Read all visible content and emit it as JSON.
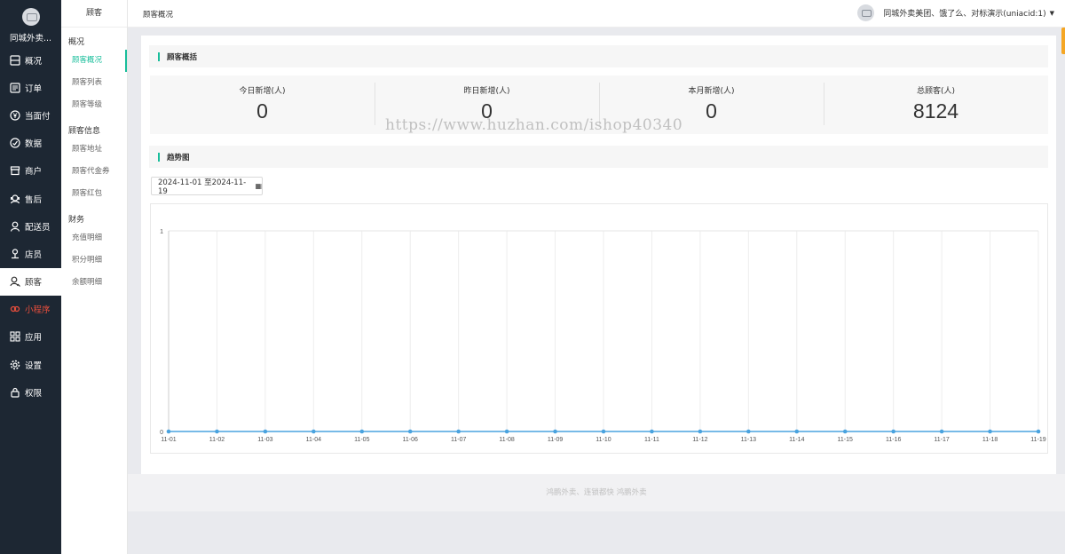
{
  "brand": {
    "name": "同城外卖..."
  },
  "nav": [
    {
      "key": "overview",
      "label": "概况",
      "icon": "overview-icon"
    },
    {
      "key": "orders",
      "label": "订单",
      "icon": "order-list-icon"
    },
    {
      "key": "pay",
      "label": "当面付",
      "icon": "yen-icon"
    },
    {
      "key": "data",
      "label": "数据",
      "icon": "dashboard-icon"
    },
    {
      "key": "merchant",
      "label": "商户",
      "icon": "store-icon"
    },
    {
      "key": "aftersale",
      "label": "售后",
      "icon": "support-icon"
    },
    {
      "key": "delivery",
      "label": "配送员",
      "icon": "courier-icon"
    },
    {
      "key": "clerk",
      "label": "店员",
      "icon": "clerk-icon"
    },
    {
      "key": "customer",
      "label": "顾客",
      "icon": "customer-icon"
    },
    {
      "key": "miniapp",
      "label": "小程序",
      "icon": "miniapp-icon"
    },
    {
      "key": "apps",
      "label": "应用",
      "icon": "apps-icon"
    },
    {
      "key": "settings",
      "label": "设置",
      "icon": "gear-icon"
    },
    {
      "key": "permissions",
      "label": "权限",
      "icon": "lock-icon"
    }
  ],
  "subnav": {
    "title": "顾客",
    "groups": [
      {
        "label": "概况",
        "items": [
          "顾客概况",
          "顾客列表",
          "顾客等级"
        ]
      },
      {
        "label": "顾客信息",
        "items": [
          "顾客地址",
          "顾客代金券",
          "顾客红包"
        ]
      },
      {
        "label": "财务",
        "items": [
          "充值明细",
          "积分明细",
          "余额明细"
        ]
      }
    ]
  },
  "topbar": {
    "breadcrumb": "顾客概况",
    "user": "同城外卖美团、饿了么、对标演示(uniacid:1)"
  },
  "summary": {
    "title": "顾客概括",
    "stats": [
      {
        "label": "今日新增(人)",
        "value": "0"
      },
      {
        "label": "昨日新增(人)",
        "value": "0"
      },
      {
        "label": "本月新增(人)",
        "value": "0"
      },
      {
        "label": "总顾客(人)",
        "value": "8124"
      }
    ]
  },
  "trend": {
    "title": "趋势图",
    "date_range": "2024-11-01 至2024-11-19"
  },
  "chart_data": {
    "type": "line",
    "x": [
      "11-01",
      "11-02",
      "11-03",
      "11-04",
      "11-05",
      "11-06",
      "11-07",
      "11-08",
      "11-09",
      "11-10",
      "11-11",
      "11-12",
      "11-13",
      "11-14",
      "11-15",
      "11-16",
      "11-17",
      "11-18",
      "11-19"
    ],
    "series": [
      {
        "values": [
          0,
          0,
          0,
          0,
          0,
          0,
          0,
          0,
          0,
          0,
          0,
          0,
          0,
          0,
          0,
          0,
          0,
          0,
          0
        ]
      }
    ],
    "y_ticks": [
      "0",
      "1"
    ],
    "ylim": [
      0,
      1
    ],
    "grid": true,
    "color": "#4aa3df"
  },
  "footer": {
    "text": "鸿鹏外卖、连锁都快 鸿鹏外卖"
  },
  "watermark": "https://www.huzhan.com/ishop40340"
}
